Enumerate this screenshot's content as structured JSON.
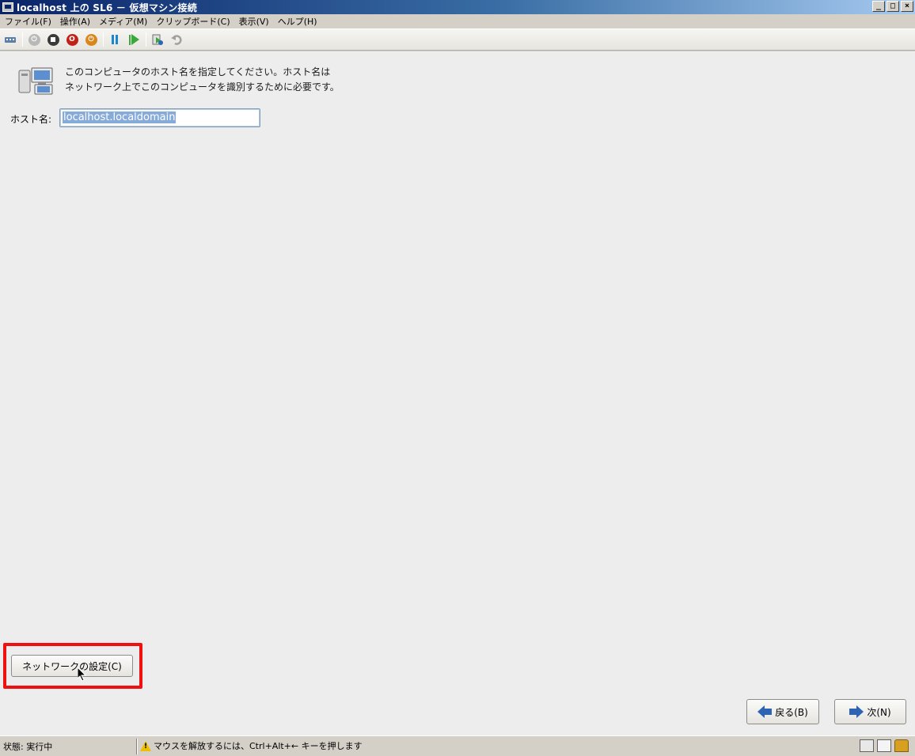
{
  "window": {
    "title": "localhost 上の SL6 － 仮想マシン接続",
    "controls": [
      "_",
      "□",
      "×"
    ]
  },
  "menubar": {
    "items": [
      "ファイル(F)",
      "操作(A)",
      "メディア(M)",
      "クリップボード(C)",
      "表示(V)",
      "ヘルプ(H)"
    ]
  },
  "toolbar": {
    "icons": [
      "ctrl-alt-del-icon",
      "start-icon",
      "turn-off-icon",
      "shutdown-icon",
      "save-icon",
      "pause-icon",
      "resume-icon",
      "checkpoint-icon",
      "revert-icon"
    ]
  },
  "installer": {
    "description_line1": "このコンピュータのホスト名を指定してください。ホスト名は",
    "description_line2": "ネットワーク上でこのコンピュータを識別するために必要です。",
    "hostname_label": "ホスト名:",
    "hostname_value": "localhost.localdomain",
    "network_button": "ネットワークの設定(C)",
    "back_button": "戻る(B)",
    "next_button": "次(N)"
  },
  "statusbar": {
    "state": "状態: 実行中",
    "message": "マウスを解放するには、Ctrl+Alt+← キーを押します"
  },
  "colors": {
    "highlight": "#f01010",
    "titlebar_start": "#0a246a",
    "selection": "#86abd9"
  }
}
